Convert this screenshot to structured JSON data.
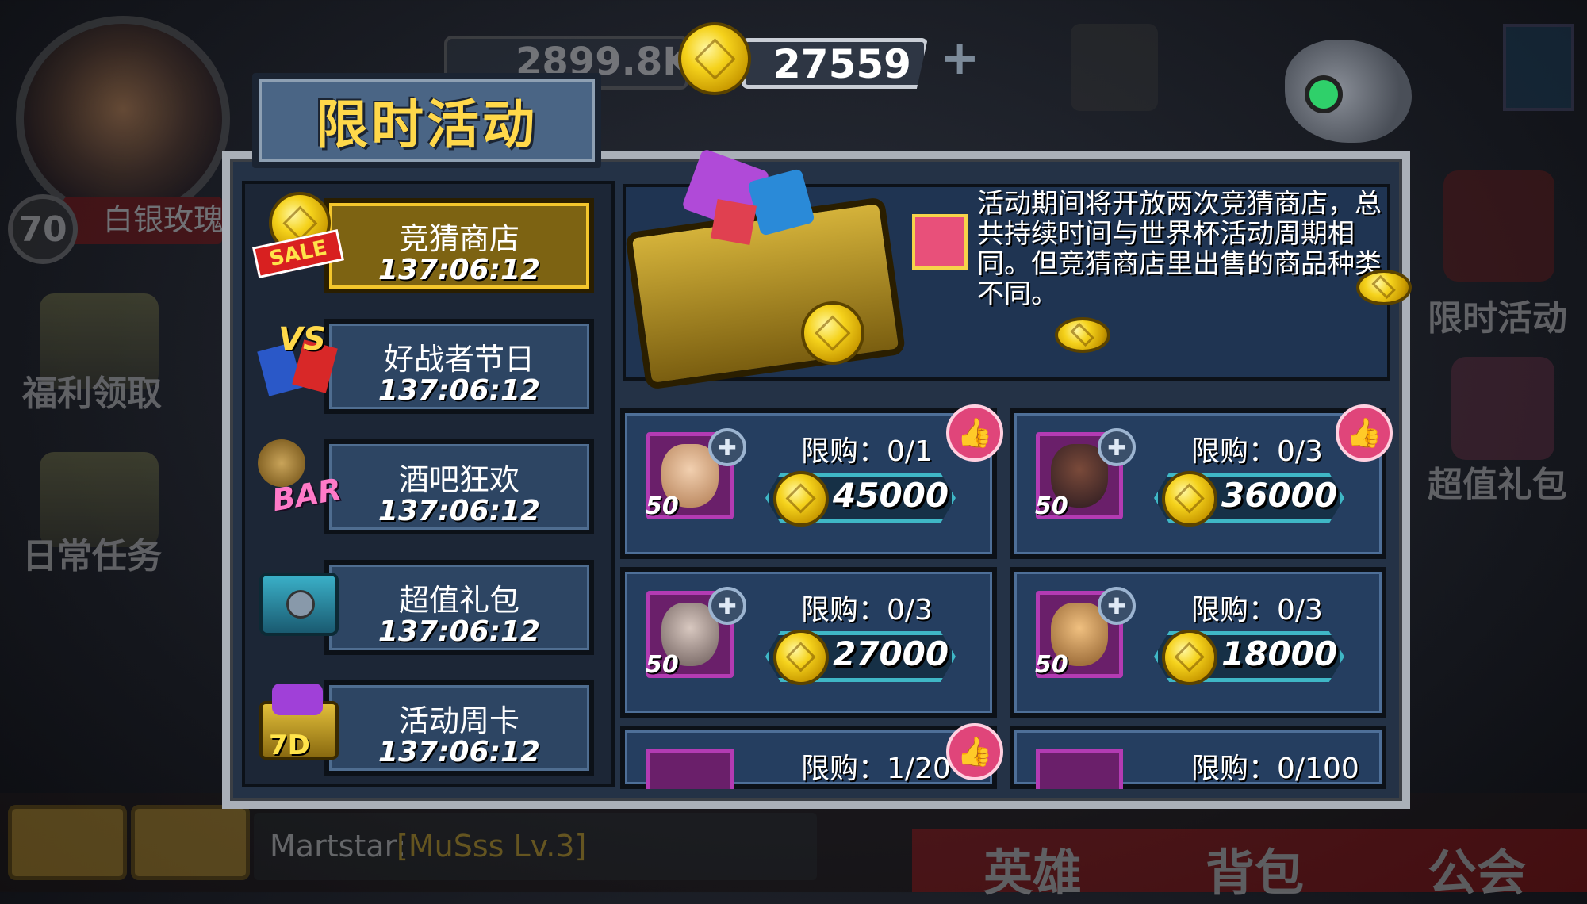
{
  "background": {
    "player": {
      "level": "70",
      "rank": "白银玫瑰"
    },
    "left_menu": [
      "福利领取",
      "日常任务"
    ],
    "right_menu": [
      "限时活动",
      "超值礼包"
    ],
    "resource": {
      "value": "2899.8K"
    },
    "chat": {
      "sender": "Martstar:",
      "message": "[MuSss Lv.3]"
    },
    "bottom_nav": [
      "英雄",
      "背包",
      "公会"
    ]
  },
  "top_bar": {
    "coin_value": "27559",
    "plus_label": "+"
  },
  "panel": {
    "title": "限时活动",
    "tabs": [
      {
        "name": "竞猜商店",
        "time": "137:06:12",
        "icon": "sale",
        "badge": "SALE",
        "active": true
      },
      {
        "name": "好战者节日",
        "time": "137:06:12",
        "icon": "vs",
        "badge": "VS",
        "active": false
      },
      {
        "name": "酒吧狂欢",
        "time": "137:06:12",
        "icon": "bar",
        "badge": "BAR",
        "active": false
      },
      {
        "name": "超值礼包",
        "time": "137:06:12",
        "icon": "gift-box",
        "badge": "",
        "active": false
      },
      {
        "name": "活动周卡",
        "time": "137:06:12",
        "icon": "week-card",
        "badge": "7D",
        "active": false
      }
    ],
    "banner_text": "活动期间将开放两次竞猜商店，总共持续时间与世界杯活动周期相同。但竞猜商店里出售的商品种类不同。",
    "items": [
      {
        "limit": "限购：0/1",
        "price": "45000",
        "level": "50",
        "liked": true
      },
      {
        "limit": "限购：0/3",
        "price": "36000",
        "level": "50",
        "liked": true
      },
      {
        "limit": "限购：0/3",
        "price": "27000",
        "level": "50",
        "liked": false
      },
      {
        "limit": "限购：0/3",
        "price": "18000",
        "level": "50",
        "liked": false
      },
      {
        "limit": "限购：1/20",
        "price": "",
        "level": "",
        "liked": true
      },
      {
        "limit": "限购：0/100",
        "price": "",
        "level": "",
        "liked": false
      }
    ]
  }
}
